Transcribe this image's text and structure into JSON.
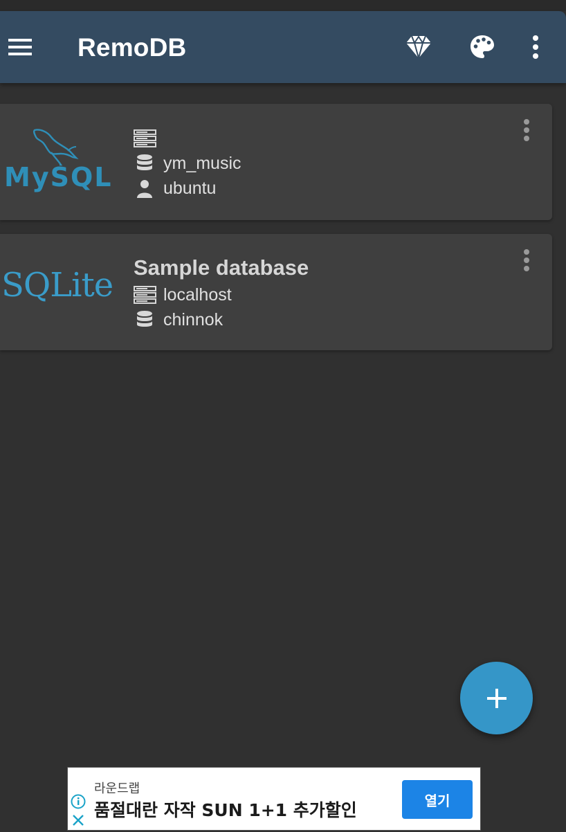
{
  "app_bar": {
    "title": "RemoDB",
    "icons": [
      "menu-icon",
      "diamond-icon",
      "palette-icon",
      "more-vert-icon"
    ],
    "background": "#344b61"
  },
  "connections": [
    {
      "logo_text": "MySQL",
      "title": "",
      "rows": [
        {
          "icon": "server-icon",
          "value": ""
        },
        {
          "icon": "database-icon",
          "value": "ym_music"
        },
        {
          "icon": "user-icon",
          "value": "ubuntu"
        }
      ]
    },
    {
      "logo_text": "SQLite",
      "title": "Sample database",
      "rows": [
        {
          "icon": "server-icon",
          "value": "localhost"
        },
        {
          "icon": "database-icon",
          "value": "chinnok"
        }
      ]
    }
  ],
  "fab": {
    "icon": "plus-icon",
    "color": "#3596c8"
  },
  "ad": {
    "advertiser": "라운드랩",
    "headline": "품절대란 자작 SUN 1+1 추가할인",
    "button_label": "열기",
    "button_color": "#1c84e6"
  },
  "colors": {
    "background": "#303030",
    "card": "#3f3f3f",
    "mysql_blue": "#2f8fb8",
    "sqlite_blue": "#3a9cc9"
  }
}
